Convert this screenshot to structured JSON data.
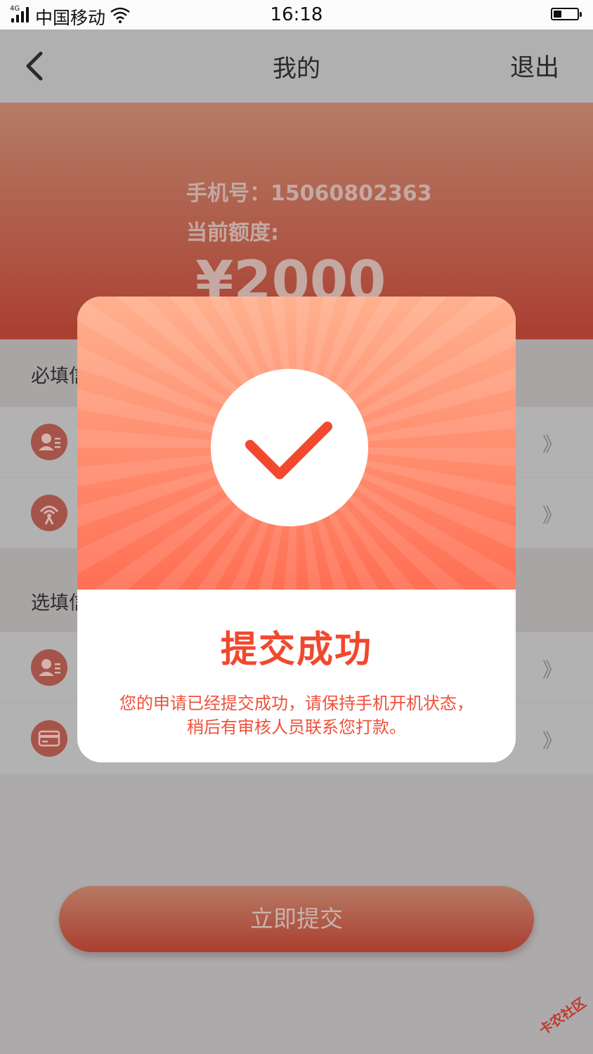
{
  "status_bar": {
    "network": "4G",
    "carrier": "中国移动",
    "time": "16:18",
    "battery_level": 0.35
  },
  "nav": {
    "title": "我的",
    "logout_label": "退出"
  },
  "header": {
    "phone_line": "手机号：15060802363",
    "quota_label": "当前额度:",
    "amount": "¥2000"
  },
  "sections": {
    "required_title": "必填信",
    "optional_title": "选填信"
  },
  "rows": {
    "chevron": "》",
    "icons": [
      "identity-card-icon",
      "signal-tower-icon",
      "identity-card-icon",
      "bank-card-icon"
    ]
  },
  "submit_label": "立即提交",
  "modal": {
    "title": "提交成功",
    "message_line1": "您的申请已经提交成功，请保持手机开机状态，",
    "message_line2": "稍后有审核人员联系您打款。"
  },
  "watermark": "卡农社区",
  "colors": {
    "accent_red": "#f2482e",
    "header_top": "#b47c66",
    "header_bottom": "#aa3f31",
    "modal_gradient_top": "#ffb08e",
    "modal_gradient_bottom": "#ff6f54"
  }
}
